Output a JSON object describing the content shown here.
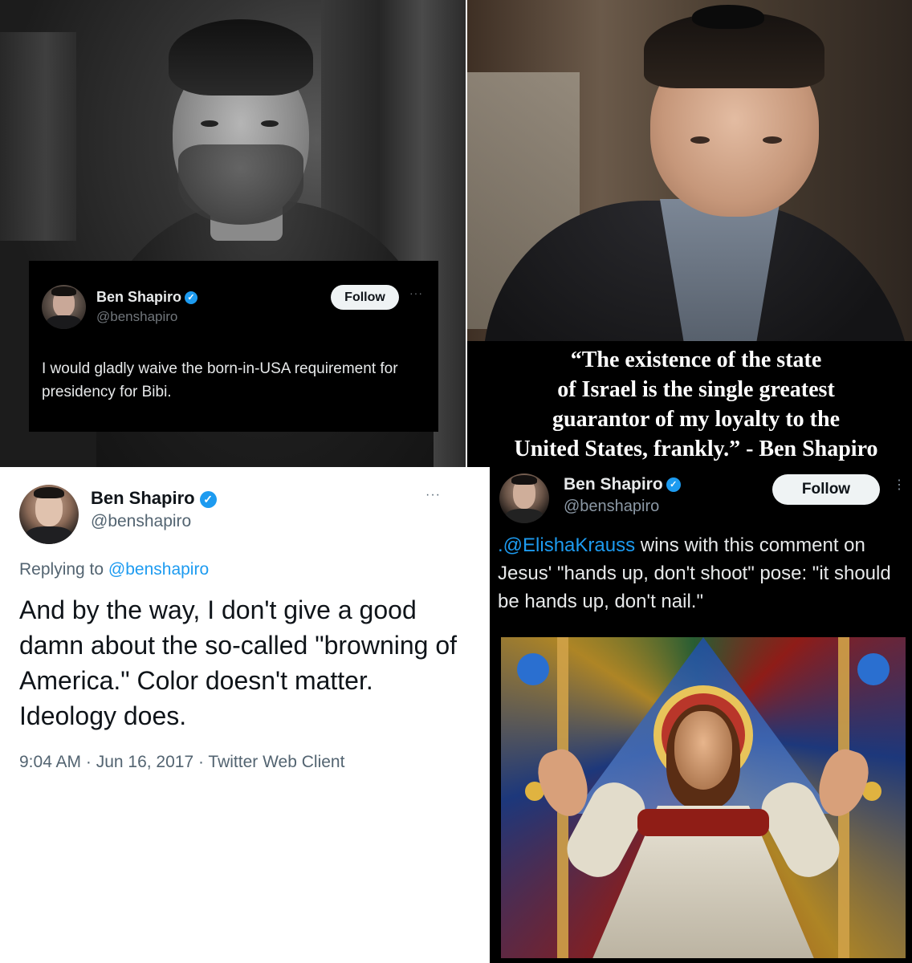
{
  "panel_top_left": {
    "tweet": {
      "display_name": "Ben Shapiro",
      "handle": "@benshapiro",
      "follow_label": "Follow",
      "more_label": "···",
      "verified_icon": "✓",
      "text": "I would gladly waive the born-in-USA requirement for presidency for Bibi."
    }
  },
  "panel_top_right": {
    "quote_lines": [
      "“The existence of the state",
      "of Israel is the single greatest",
      "guarantor of my loyalty to the",
      "United States, frankly.” - Ben Shapiro"
    ]
  },
  "panel_bottom_left": {
    "tweet": {
      "display_name": "Ben Shapiro",
      "handle": "@benshapiro",
      "more_label": "···",
      "verified_icon": "✓",
      "replying_prefix": "Replying to",
      "replying_to": "@benshapiro",
      "text": "And by the way, I don't give a good damn about the so-called \"browning of America.\" Color doesn't matter. Ideology does.",
      "meta": "9:04 AM · Jun 16, 2017 · Twitter Web Client"
    }
  },
  "panel_bottom_right": {
    "tweet": {
      "display_name": "Ben Shapiro",
      "handle": "@benshapiro",
      "follow_label": "Follow",
      "more_label": "⋮",
      "verified_icon": "✓",
      "mention": ".@ElishaKrauss",
      "text": " wins with this comment on Jesus' \"hands up, don't shoot\" pose: \"it should be hands up, don't nail.\""
    }
  },
  "colors": {
    "twitter_blue": "#1d9bf0",
    "dark_card_bg": "#000000",
    "light_card_bg": "#ffffff"
  }
}
